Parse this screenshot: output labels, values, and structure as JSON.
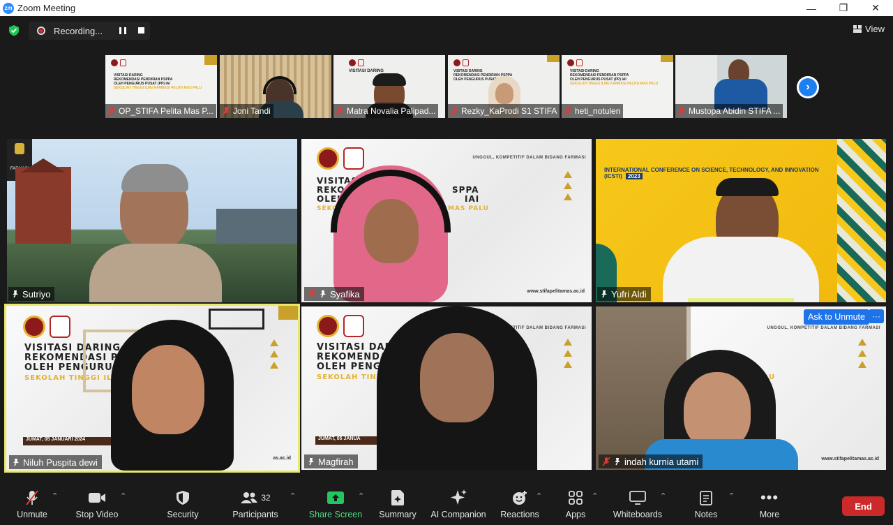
{
  "window": {
    "title": "Zoom Meeting",
    "logo_text": "zm",
    "minimize": "—",
    "restore": "❐",
    "close": "✕"
  },
  "recording": {
    "label": "Recording..."
  },
  "view_button": {
    "label": "View"
  },
  "strip": [
    {
      "name": "OP_STIFA Pelita Mas P...",
      "muted": true
    },
    {
      "name": "Joni Tandi",
      "muted": true
    },
    {
      "name": "Matra Novalia Palipad...",
      "muted": true
    },
    {
      "name": "Rezky_KaProdi S1 STIFA",
      "muted": true
    },
    {
      "name": "heti_notulen",
      "muted": true
    },
    {
      "name": "Mustopa Abidin STIFA ...",
      "muted": true
    }
  ],
  "strip_slide": {
    "line1": "VISITASI DARING",
    "line2": "REKOMENDASI PENDIRIAN PSPPA",
    "line3": "OLEH PENGURUS PUSAT (PP) IAI",
    "line4": "SEKOLAH TINGGI ILMU FARMASI PELITA MAS PALU"
  },
  "gallery": [
    {
      "name": "Sutriyo",
      "muted": false
    },
    {
      "name": "Syafika",
      "muted": true
    },
    {
      "name": "Yufri Aldi",
      "muted": false
    },
    {
      "name": "Niluh Puspita dewi",
      "muted": false
    },
    {
      "name": "Magfirah",
      "muted": false
    },
    {
      "name": "indah kurnia utami",
      "muted": true
    }
  ],
  "tile_texts": {
    "farmasi": "FARMASI",
    "slide_tag": "UNGGUL, KOMPETITIF DALAM BIDANG FARMASI",
    "slide_title1": "VISITASI DARING",
    "slide_title2_a": "REKOMENDASI PEND",
    "slide_title3_a": "OLEH PENGURUS PU",
    "slide_sub_a": "SEKOLAH TINGGI ILMU FAR",
    "slide_title_syafika1": "VISITAS",
    "slide_title_syafika2": "REKOMEN",
    "slide_title_syafika3": "OLEH PE",
    "slide_right_syafika1": "SPPA",
    "slide_right_syafika2": "IAI",
    "slide_sub_syafika_a": "SEKOL",
    "slide_sub_syafika_b": "MAS PALU",
    "slide_sub_indah": "U",
    "date_a": "JUMAT, 05 JANUARI 2024",
    "date_b": "JUMAT, 05 JANUA",
    "url": "www.stifapelitamas.ac.id",
    "url_short": "as.ac.id",
    "conference": "INTERNATIONAL CONFERENCE ON SCIENCE, TECHNOLOGY, AND INNOVATION (ICSTI)",
    "conference_year": "2023"
  },
  "ask_unmute": "Ask to Unmute",
  "more": "···",
  "toolbar": {
    "unmute": "Unmute",
    "stop_video": "Stop Video",
    "security": "Security",
    "participants": "Participants",
    "participants_count": "32",
    "share_screen": "Share Screen",
    "summary": "Summary",
    "ai_companion": "AI Companion",
    "reactions": "Reactions",
    "apps": "Apps",
    "whiteboards": "Whiteboards",
    "notes": "Notes",
    "more": "More",
    "end": "End"
  },
  "colors": {
    "accent": "#2d8cff",
    "end": "#cc2a2a",
    "share": "#22c55e",
    "slide_gold": "#e4b230",
    "conference_yellow": "#f6c81a"
  }
}
